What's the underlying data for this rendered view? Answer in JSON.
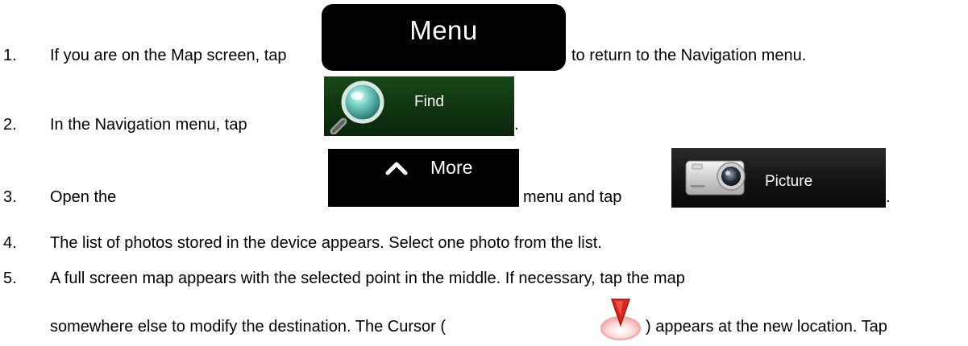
{
  "steps": [
    {
      "num": "1.",
      "text_before": "If you are on the Map screen, tap",
      "text_after": "to return to the Navigation menu."
    },
    {
      "num": "2.",
      "text_before": "In the Navigation menu, tap",
      "text_after": "."
    },
    {
      "num": "3.",
      "text_before": "Open the",
      "text_middle": "menu and tap",
      "text_after": "."
    },
    {
      "num": "4.",
      "text": "The list of photos stored in the device appears. Select one photo from the list."
    },
    {
      "num": "5.",
      "text": "A full screen map appears with the selected point in the middle. If necessary, tap the map",
      "text_cont_before": "somewhere else to modify the destination. The Cursor (",
      "text_cont_after": ") appears at the new location. Tap"
    }
  ],
  "buttons": {
    "menu": "Menu",
    "find": "Find",
    "more": "More",
    "picture": "Picture"
  },
  "icons": {
    "find": "magnifier-icon",
    "more": "chevron-up-icon",
    "picture": "camera-icon",
    "cursor": "cursor-icon"
  },
  "colors": {
    "find_bg": "#143f14",
    "menu_bg": "#000000",
    "cursor_red": "#d9261c"
  }
}
